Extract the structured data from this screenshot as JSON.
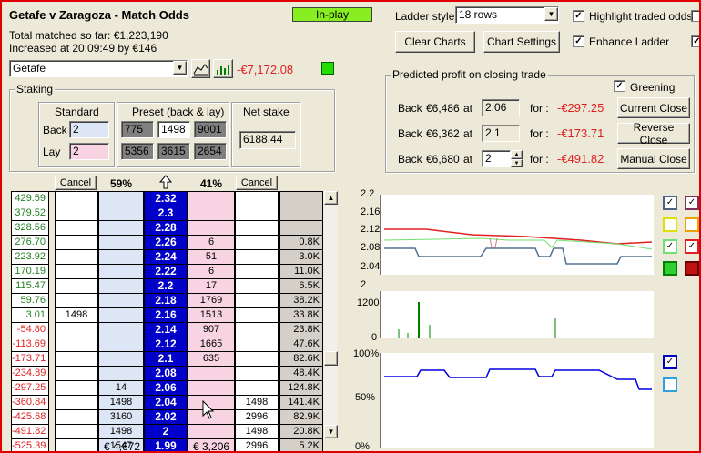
{
  "header": {
    "title": "Getafe v Zaragoza - Match Odds",
    "total_matched": "Total matched so far: €1,223,190",
    "increased": "Increased at 20:09:49 by €146",
    "inplay": "In-play"
  },
  "selection": {
    "runner": "Getafe",
    "profit": "-€7,172.08"
  },
  "ladder_style": {
    "label": "Ladder style",
    "value": "18 rows"
  },
  "options": {
    "highlight": "Highlight traded odds",
    "enhance": "Enhance Ladder"
  },
  "buttons": {
    "clear_charts": "Clear Charts",
    "chart_settings": "Chart Settings"
  },
  "staking": {
    "title": "Staking",
    "standard": "Standard",
    "preset": "Preset (back & lay)",
    "net_stake_label": "Net stake",
    "back_label": "Back",
    "lay_label": "Lay",
    "back_value": "2",
    "lay_value": "2",
    "preset_back": [
      "775",
      "1498",
      "9001"
    ],
    "preset_lay": [
      "5356",
      "3615",
      "2654"
    ],
    "net_stake": "6188.44"
  },
  "predicted": {
    "title": "Predicted profit on closing trade",
    "greening": "Greening",
    "rows": [
      {
        "back": "Back",
        "stake": "€6,486",
        "at": "at",
        "odds": "2.06",
        "for": "for :",
        "profit": "-€297.25",
        "button": "Current Close"
      },
      {
        "back": "Back",
        "stake": "€6,362",
        "at": "at",
        "odds": "2.1",
        "for": "for :",
        "profit": "-€173.71",
        "button": "Reverse Close"
      },
      {
        "back": "Back",
        "stake": "€6,680",
        "at": "at",
        "odds": "2",
        "for": "for :",
        "profit": "-€491.82",
        "button": "Manual Close"
      }
    ]
  },
  "ladder": {
    "cancel": "Cancel",
    "back_pct": "59%",
    "lay_pct": "41%",
    "back_total": "€ 4,672",
    "lay_total": "€ 3,206",
    "rows": [
      {
        "pnl": "429.59",
        "back": "",
        "bv": "",
        "odds": "2.32",
        "lv": "",
        "lay": "",
        "tv": ""
      },
      {
        "pnl": "379.52",
        "back": "",
        "bv": "",
        "odds": "2.3",
        "lv": "",
        "lay": "",
        "tv": ""
      },
      {
        "pnl": "328.56",
        "back": "",
        "bv": "",
        "odds": "2.28",
        "lv": "",
        "lay": "",
        "tv": ""
      },
      {
        "pnl": "276.70",
        "back": "",
        "bv": "",
        "odds": "2.26",
        "lv": "6",
        "lay": "",
        "tv": "0.8K"
      },
      {
        "pnl": "223.92",
        "back": "",
        "bv": "",
        "odds": "2.24",
        "lv": "51",
        "lay": "",
        "tv": "3.0K"
      },
      {
        "pnl": "170.19",
        "back": "",
        "bv": "",
        "odds": "2.22",
        "lv": "6",
        "lay": "",
        "tv": "11.0K"
      },
      {
        "pnl": "115.47",
        "back": "",
        "bv": "",
        "odds": "2.2",
        "lv": "17",
        "lay": "",
        "tv": "6.5K"
      },
      {
        "pnl": "59.76",
        "back": "",
        "bv": "",
        "odds": "2.18",
        "lv": "1769",
        "lay": "",
        "tv": "38.2K"
      },
      {
        "pnl": "3.01",
        "back": "1498",
        "bv": "",
        "odds": "2.16",
        "lv": "1513",
        "lay": "",
        "tv": "33.8K"
      },
      {
        "pnl": "-54.80",
        "back": "",
        "bv": "",
        "odds": "2.14",
        "lv": "907",
        "lay": "",
        "tv": "23.8K"
      },
      {
        "pnl": "-113.69",
        "back": "",
        "bv": "",
        "odds": "2.12",
        "lv": "1665",
        "lay": "",
        "tv": "47.6K"
      },
      {
        "pnl": "-173.71",
        "back": "",
        "bv": "",
        "odds": "2.1",
        "lv": "635",
        "lay": "",
        "tv": "82.6K"
      },
      {
        "pnl": "-234.89",
        "back": "",
        "bv": "",
        "odds": "2.08",
        "lv": "",
        "lay": "",
        "tv": "48.4K"
      },
      {
        "pnl": "-297.25",
        "back": "",
        "bv": "14",
        "odds": "2.06",
        "lv": "",
        "lay": "",
        "tv": "124.8K"
      },
      {
        "pnl": "-360.84",
        "back": "",
        "bv": "1498",
        "odds": "2.04",
        "lv": "",
        "lay": "1498",
        "tv": "141.4K"
      },
      {
        "pnl": "-425.68",
        "back": "",
        "bv": "3160",
        "odds": "2.02",
        "lv": "",
        "lay": "2996",
        "tv": "82.9K"
      },
      {
        "pnl": "-491.82",
        "back": "",
        "bv": "1498",
        "odds": "2",
        "lv": "",
        "lay": "1498",
        "tv": "20.8K"
      },
      {
        "pnl": "-525.39",
        "back": "",
        "bv": "1547",
        "odds": "1.99",
        "lv": "",
        "lay": "2996",
        "tv": "5.2K"
      }
    ]
  },
  "charts": {
    "price_ticks": [
      "2.2",
      "2.16",
      "2.12",
      "2.08",
      "2.04",
      "2"
    ],
    "volume_ticks": [
      "1200",
      "0"
    ],
    "pct_ticks": [
      "100%",
      "50%",
      "0%"
    ]
  },
  "colors": {
    "positive": "#208020",
    "negative": "#e02020",
    "odds_bg": "#0000c8",
    "back_bg": "#dde6f4",
    "lay_bg": "#f8d4e2",
    "inplay_bg": "#88ee22"
  }
}
